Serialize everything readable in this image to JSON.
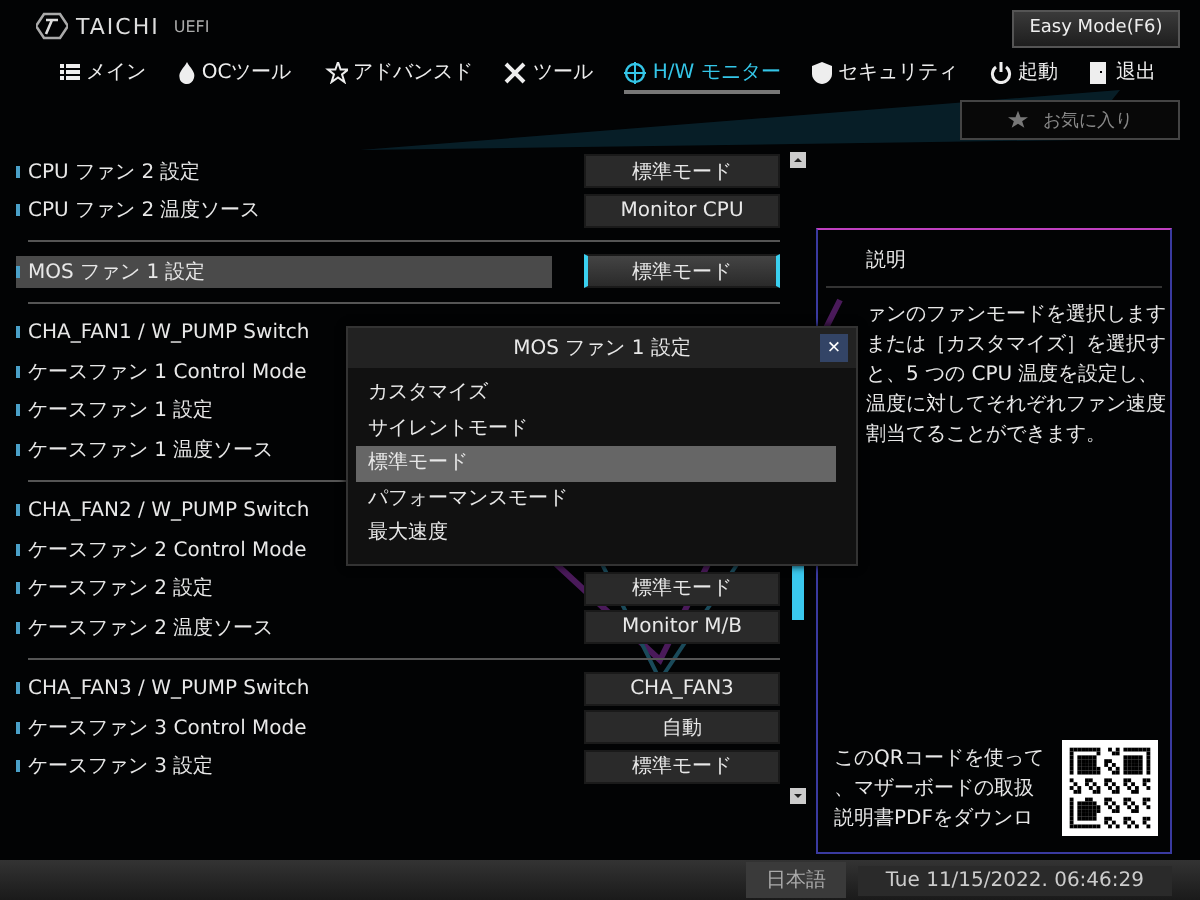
{
  "header": {
    "brand": "TAICHI",
    "brand_suffix": "UEFI",
    "mode_button": "Easy Mode(F6)"
  },
  "tabs": [
    {
      "label": "メイン",
      "selected": false
    },
    {
      "label": "OCツール",
      "selected": false
    },
    {
      "label": "アドバンスド",
      "selected": false
    },
    {
      "label": "ツール",
      "selected": false
    },
    {
      "label": "H/W モニター",
      "selected": true
    },
    {
      "label": "セキュリティ",
      "selected": false
    },
    {
      "label": "起動",
      "selected": false
    },
    {
      "label": "退出",
      "selected": false
    }
  ],
  "favorites_button": "お気に入り",
  "groups": [
    {
      "rows": [
        {
          "label": "CPU ファン 2 設定",
          "value": "標準モード",
          "selected": false
        },
        {
          "label": "CPU ファン 2 温度ソース",
          "value": "Monitor CPU",
          "selected": false
        }
      ]
    },
    {
      "rows": [
        {
          "label": "MOS ファン 1 設定",
          "value": "標準モード",
          "selected": true
        }
      ]
    },
    {
      "rows": [
        {
          "label": "CHA_FAN1 / W_PUMP Switch",
          "selected": false
        },
        {
          "label": "ケースファン 1 Control Mode",
          "selected": false
        },
        {
          "label": "ケースファン 1 設定",
          "selected": false
        },
        {
          "label": "ケースファン 1 温度ソース",
          "selected": false
        }
      ]
    },
    {
      "rows": [
        {
          "label": "CHA_FAN2 / W_PUMP Switch",
          "selected": false
        },
        {
          "label": "ケースファン 2 Control Mode",
          "selected": false
        },
        {
          "label": "ケースファン 2 設定",
          "value": "標準モード",
          "selected": false
        },
        {
          "label": "ケースファン 2 温度ソース",
          "value": "Monitor M/B",
          "selected": false
        }
      ]
    },
    {
      "rows": [
        {
          "label": "CHA_FAN3 / W_PUMP Switch",
          "value": "CHA_FAN3",
          "selected": false
        },
        {
          "label": "ケースファン 3 Control Mode",
          "value": "自動",
          "selected": false
        },
        {
          "label": "ケースファン 3 設定",
          "value": "標準モード",
          "selected": false
        }
      ]
    }
  ],
  "description": {
    "title": "説明",
    "lines": [
      "ァンのファンモードを選択します",
      "または［カスタマイズ］を選択す",
      "と、5 つの CPU 温度を設定し、",
      "温度に対してそれぞれファン速度",
      "割当てることができます。"
    ],
    "qr_text": [
      "このQRコードを使って",
      "、マザーボードの取扱",
      "説明書PDFをダウンロ"
    ]
  },
  "dialog": {
    "title": "MOS ファン 1 設定",
    "close": "×",
    "options": [
      {
        "label": "カスタマイズ",
        "selected": false
      },
      {
        "label": "サイレントモード",
        "selected": false
      },
      {
        "label": "標準モード",
        "selected": true
      },
      {
        "label": "パフォーマンスモード",
        "selected": false
      },
      {
        "label": "最大速度",
        "selected": false
      }
    ]
  },
  "status_bar": {
    "language": "日本語",
    "datetime": "Tue 11/15/2022. 06:46:29"
  }
}
